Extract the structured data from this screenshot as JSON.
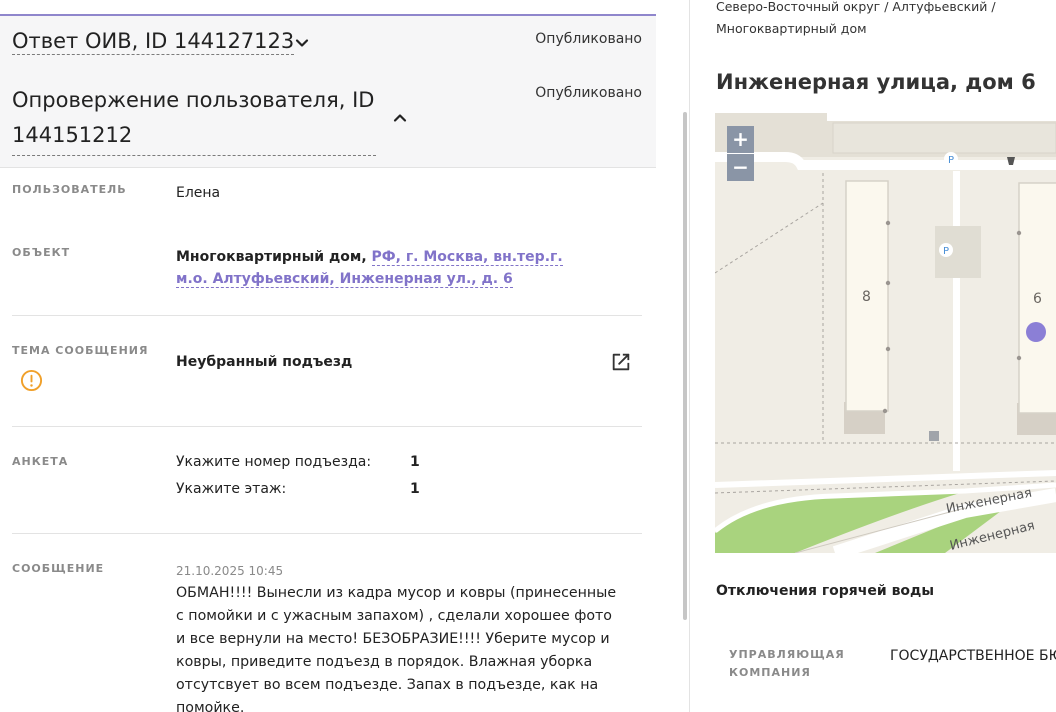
{
  "left": {
    "oiv": {
      "title": "Ответ ОИВ, ID 144127123",
      "status": "Опубликовано"
    },
    "refutation": {
      "title": "Опровержение пользователя, ID 144151212",
      "status": "Опубликовано"
    },
    "user": {
      "label": "Пользователь",
      "value": "Елена"
    },
    "object": {
      "label": "Объект",
      "type": "Многоквартирный дом,",
      "address": "РФ, г. Москва, вн.тер.г. м.о. Алтуфьевский, Инженерная ул., д. 6"
    },
    "topic": {
      "label": "Тема сообщения",
      "value": "Неубранный подъезд"
    },
    "form": {
      "label": "Анкета",
      "rows": [
        {
          "question": "Укажите номер подъезда:",
          "answer": "1"
        },
        {
          "question": "Укажите этаж:",
          "answer": "1"
        }
      ]
    },
    "message": {
      "label": "Сообщение",
      "date": "21.10.2025 10:45",
      "text": "ОБМАН!!!! Вынесли из кадра мусор и ковры (принесенные с помойки и с ужасным запахом) , сделали хорошее фото и все вернули на место! БЕЗОБРАЗИЕ!!!! Уберите мусор и ковры, приведите подъезд в порядок. Влажная уборка отсутсвует во всем подъезде. Запах в подъезде, как на помойке."
    }
  },
  "right": {
    "breadcrumb": "Северо-Восточный округ / Алтуфьевский / Многоквартирный дом",
    "title": "Инженерная улица, дом 6",
    "map": {
      "zoom_in": "+",
      "zoom_out": "−",
      "building_a": "8",
      "building_b": "6",
      "parking": "P",
      "street_1": "Инженерная",
      "street_2": "Инженерная",
      "marker_color": "#8b7fd6"
    },
    "hot_water": "Отключения горячей воды",
    "management": {
      "label": "Управляющая компания",
      "value": "ГОСУДАРСТВЕННОЕ БЮ МОСКВЫ «ЖИЛИЩНИК"
    }
  },
  "colors": {
    "accent": "#8173c9",
    "warning": "#f0a02a",
    "header_bg": "#f6f6f7"
  },
  "icons": {
    "expand": "chevron-down-icon",
    "collapse": "chevron-up-icon",
    "warning": "warning-circle-icon",
    "external": "external-link-icon"
  }
}
